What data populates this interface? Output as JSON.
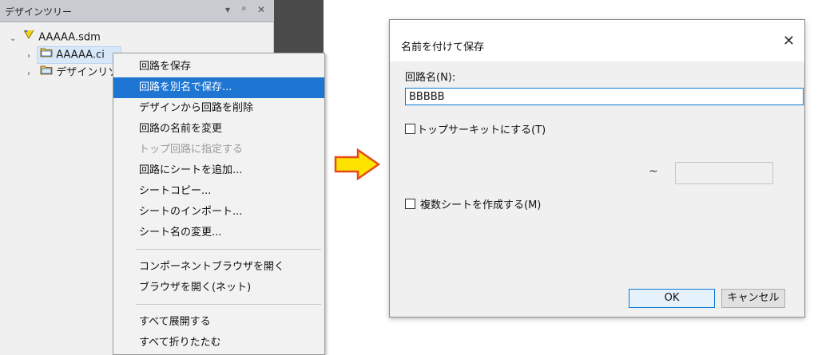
{
  "tree_panel": {
    "title": "デザインツリー",
    "controls": {
      "pin": "▾",
      "dock": "ᵖ",
      "close": "✕"
    },
    "items": [
      {
        "label": "AAAAA.sdm",
        "icon": "design-file-icon"
      },
      {
        "label": "AAAAA.ci",
        "icon": "folder-icon"
      },
      {
        "label": "デザインリソ",
        "icon": "folder-icon"
      }
    ]
  },
  "context_menu": {
    "items": [
      {
        "label": "回路を保存"
      },
      {
        "label": "回路を別名で保存..."
      },
      {
        "label": "デザインから回路を削除"
      },
      {
        "label": "回路の名前を変更"
      },
      {
        "label": "トップ回路に指定する"
      },
      {
        "label": "回路にシートを追加..."
      },
      {
        "label": "シートコピー..."
      },
      {
        "label": "シートのインポート..."
      },
      {
        "label": "シート名の変更..."
      },
      {
        "label": "コンポーネントブラウザを開く"
      },
      {
        "label": "ブラウザを開く(ネット)"
      },
      {
        "label": "すべて展開する"
      },
      {
        "label": "すべて折りたたむ"
      }
    ]
  },
  "arrow": {
    "fill": "#ffe300",
    "stroke": "#e34b1a"
  },
  "dialog": {
    "title": "名前を付けて保存",
    "close_glyph": "✕",
    "circuit_name_label": "回路名(N):",
    "circuit_name_value": "BBBBB",
    "top_circuit_label": "トップサーキットにする(T)",
    "range_tilde": "~",
    "multi_sheet_label": "複数シートを作成する(M)",
    "ok_label": "OK",
    "cancel_label": "キャンセル"
  },
  "colors": {
    "highlight": "#1e76d2",
    "focus_border": "#0a78d7"
  }
}
